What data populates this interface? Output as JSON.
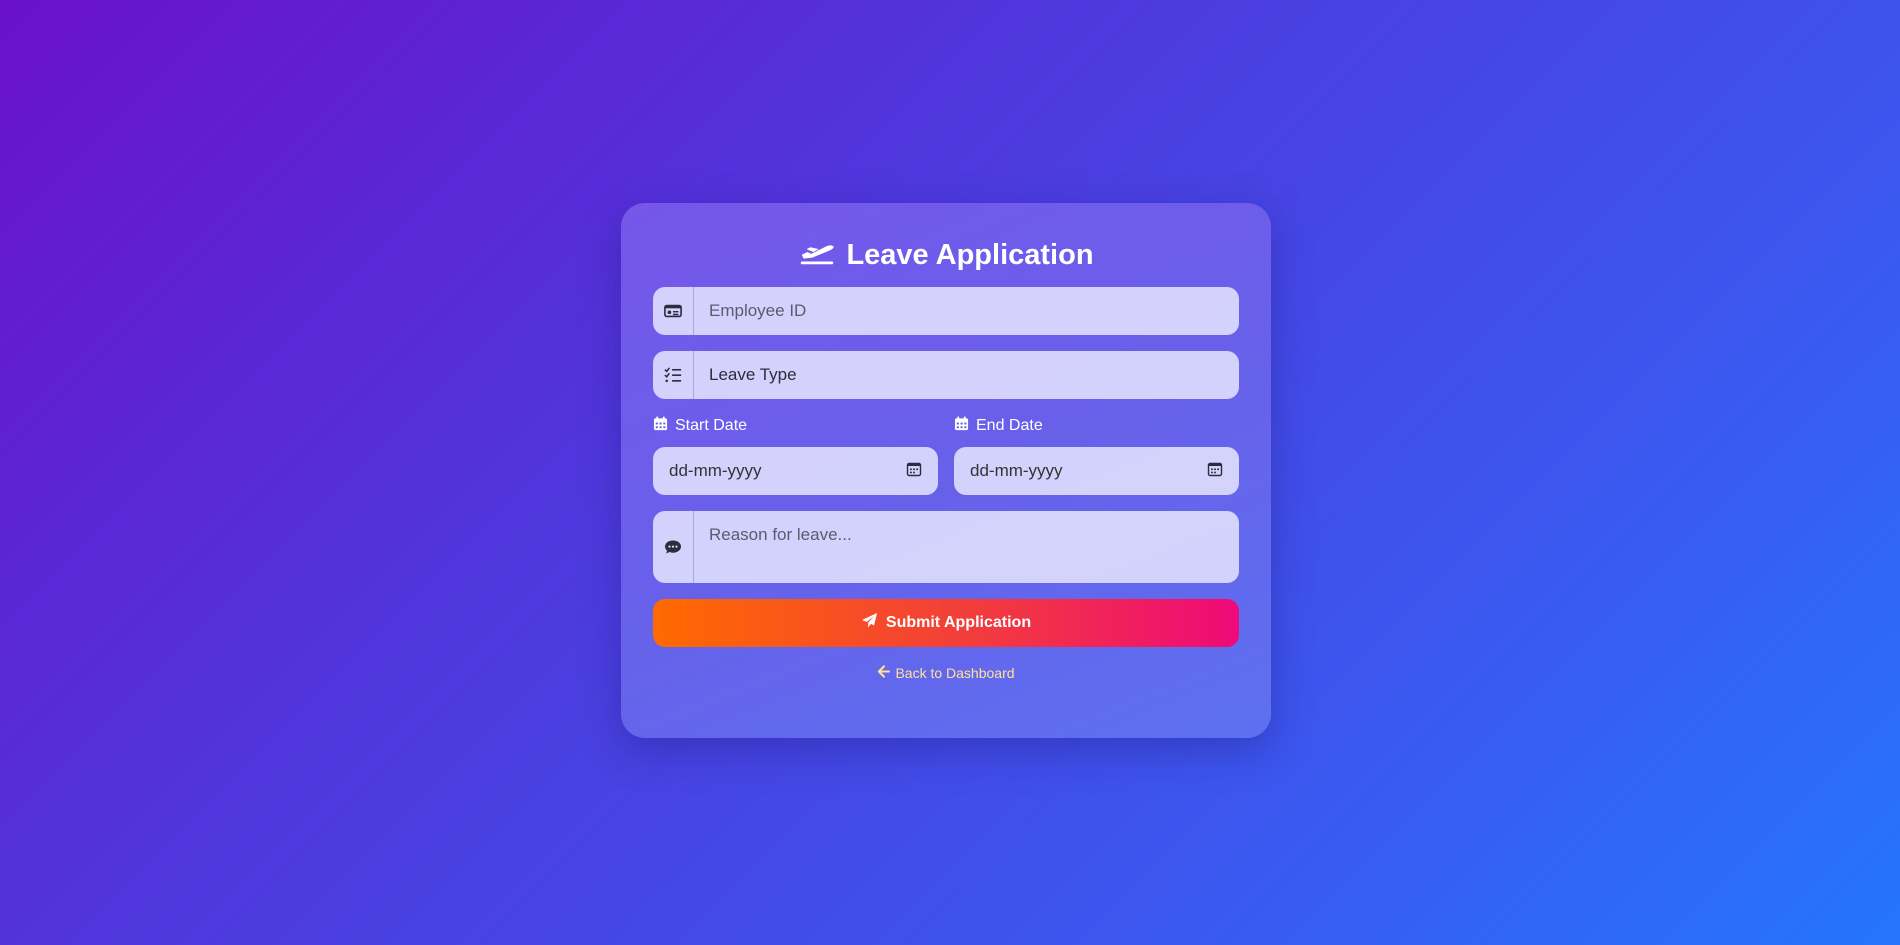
{
  "form": {
    "title": "Leave Application",
    "title_icon": "plane-departure-icon",
    "employee_id": {
      "placeholder": "Employee ID",
      "value": "",
      "icon": "id-card-icon"
    },
    "leave_type": {
      "value": "Leave Type",
      "icon": "tasks-list-icon"
    },
    "start_date": {
      "label": "Start Date",
      "value": "dd-mm-yyyy",
      "icon": "calendar-icon"
    },
    "end_date": {
      "label": "End Date",
      "value": "dd-mm-yyyy",
      "icon": "calendar-icon"
    },
    "reason": {
      "placeholder": "Reason for leave...",
      "value": "",
      "icon": "comment-dots-icon"
    },
    "submit_label": "Submit Application",
    "submit_icon": "paper-plane-icon",
    "back_link_label": "Back to Dashboard",
    "back_icon": "arrow-left-icon"
  },
  "colors": {
    "background_start": "#6a11cb",
    "background_end": "#2575fc",
    "button_start": "#ff6a00",
    "button_end": "#ee0979",
    "link": "#ffe29a"
  }
}
